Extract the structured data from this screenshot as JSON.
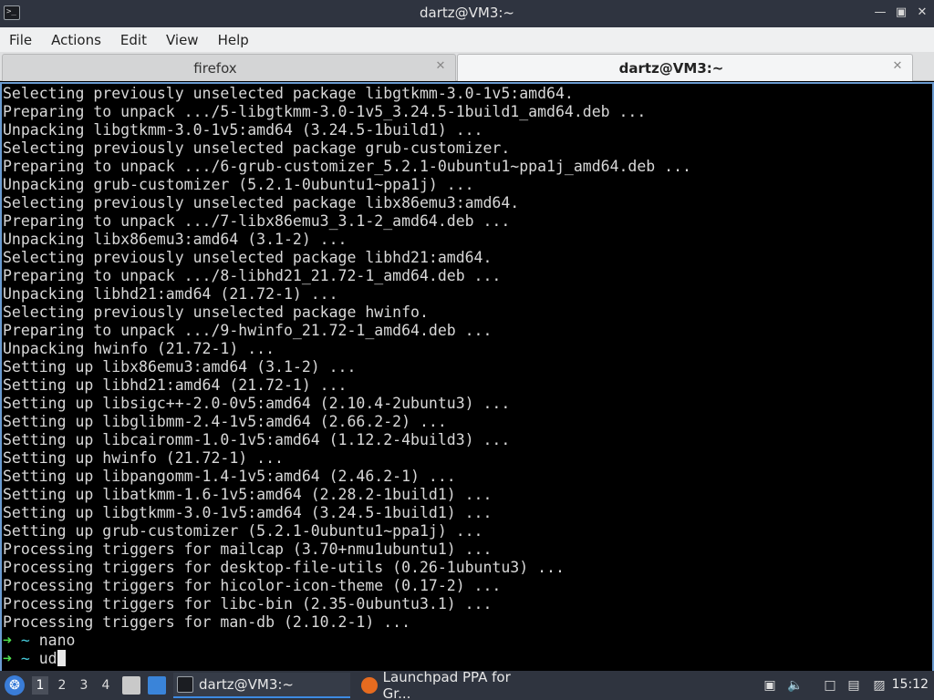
{
  "window": {
    "title": "dartz@VM3:~",
    "app_icon": ">_",
    "controls": [
      "minimize-icon",
      "maximize-icon",
      "close-icon"
    ]
  },
  "menu": [
    "File",
    "Actions",
    "Edit",
    "View",
    "Help"
  ],
  "tabs": [
    {
      "label": "firefox",
      "active": false
    },
    {
      "label": "dartz@VM3:~",
      "active": true
    }
  ],
  "terminal": {
    "lines": [
      "Selecting previously unselected package libgtkmm-3.0-1v5:amd64.",
      "Preparing to unpack .../5-libgtkmm-3.0-1v5_3.24.5-1build1_amd64.deb ...",
      "Unpacking libgtkmm-3.0-1v5:amd64 (3.24.5-1build1) ...",
      "Selecting previously unselected package grub-customizer.",
      "Preparing to unpack .../6-grub-customizer_5.2.1-0ubuntu1~ppa1j_amd64.deb ...",
      "Unpacking grub-customizer (5.2.1-0ubuntu1~ppa1j) ...",
      "Selecting previously unselected package libx86emu3:amd64.",
      "Preparing to unpack .../7-libx86emu3_3.1-2_amd64.deb ...",
      "Unpacking libx86emu3:amd64 (3.1-2) ...",
      "Selecting previously unselected package libhd21:amd64.",
      "Preparing to unpack .../8-libhd21_21.72-1_amd64.deb ...",
      "Unpacking libhd21:amd64 (21.72-1) ...",
      "Selecting previously unselected package hwinfo.",
      "Preparing to unpack .../9-hwinfo_21.72-1_amd64.deb ...",
      "Unpacking hwinfo (21.72-1) ...",
      "Setting up libx86emu3:amd64 (3.1-2) ...",
      "Setting up libhd21:amd64 (21.72-1) ...",
      "Setting up libsigc++-2.0-0v5:amd64 (2.10.4-2ubuntu3) ...",
      "Setting up libglibmm-2.4-1v5:amd64 (2.66.2-2) ...",
      "Setting up libcairomm-1.0-1v5:amd64 (1.12.2-4build3) ...",
      "Setting up hwinfo (21.72-1) ...",
      "Setting up libpangomm-1.4-1v5:amd64 (2.46.2-1) ...",
      "Setting up libatkmm-1.6-1v5:amd64 (2.28.2-1build1) ...",
      "Setting up libgtkmm-3.0-1v5:amd64 (3.24.5-1build1) ...",
      "Setting up grub-customizer (5.2.1-0ubuntu1~ppa1j) ...",
      "Processing triggers for mailcap (3.70+nmu1ubuntu1) ...",
      "Processing triggers for desktop-file-utils (0.26-1ubuntu3) ...",
      "Processing triggers for hicolor-icon-theme (0.17-2) ...",
      "Processing triggers for libc-bin (2.35-0ubuntu3.1) ...",
      "Processing triggers for man-db (2.10.2-1) ..."
    ],
    "prompts": [
      {
        "arrow": "➜",
        "dir": "~",
        "command": "nano"
      },
      {
        "arrow": "➜",
        "dir": "~",
        "command": "ud"
      }
    ]
  },
  "taskbar": {
    "start_icon": "start-menu-icon",
    "workspaces": [
      "1",
      "2",
      "3",
      "4"
    ],
    "active_workspace": "1",
    "tasks": [
      {
        "label": "dartz@VM3:~",
        "icon": "terminal-icon",
        "active": true
      },
      {
        "label": "Launchpad PPA for Gr...",
        "icon": "firefox-icon",
        "active": false
      }
    ],
    "clock": "15:12"
  },
  "colors": {
    "prompt_arrow": "#4fe04f",
    "prompt_dir": "#45c6d6",
    "terminal_bg": "#000000",
    "terminal_fg": "#d8d8d8",
    "accent": "#3d8be3"
  }
}
